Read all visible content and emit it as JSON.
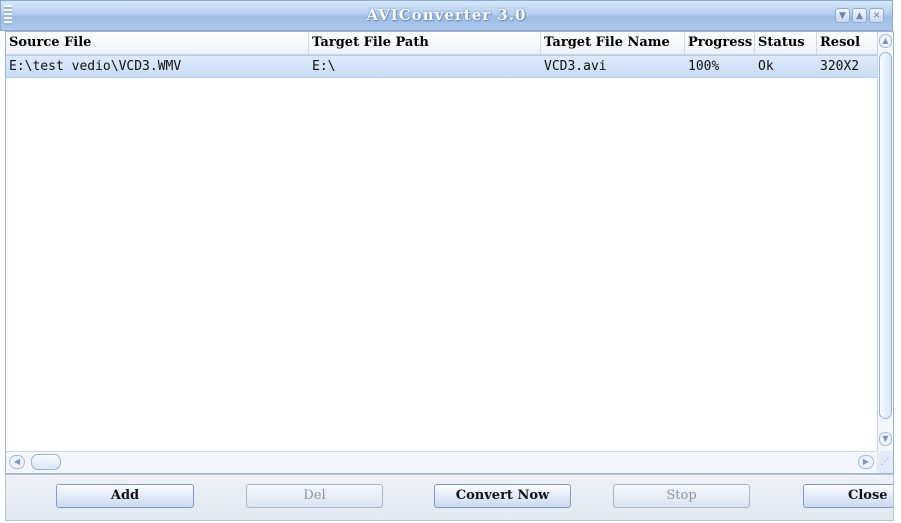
{
  "window": {
    "title": "AVIConverter 3.0",
    "buttons": [
      "minimize",
      "maximize",
      "close"
    ]
  },
  "list": {
    "columns": [
      "Source File",
      "Target File Path",
      "Target File Name",
      "Progress",
      "Status",
      "Resol"
    ],
    "rows": [
      {
        "source_file": "E:\\test vedio\\VCD3.WMV",
        "target_path": "E:\\",
        "target_name": "VCD3.avi",
        "progress": "100%",
        "status": "Ok",
        "resolution": "320X2"
      }
    ]
  },
  "buttons": {
    "add": "Add",
    "del": "Del",
    "convert": "Convert Now",
    "stop": "Stop",
    "close": "Close"
  },
  "colors": {
    "title_bar": "#aecaed",
    "selected_row": "#d3e3f8",
    "border": "#9fb4d3"
  }
}
